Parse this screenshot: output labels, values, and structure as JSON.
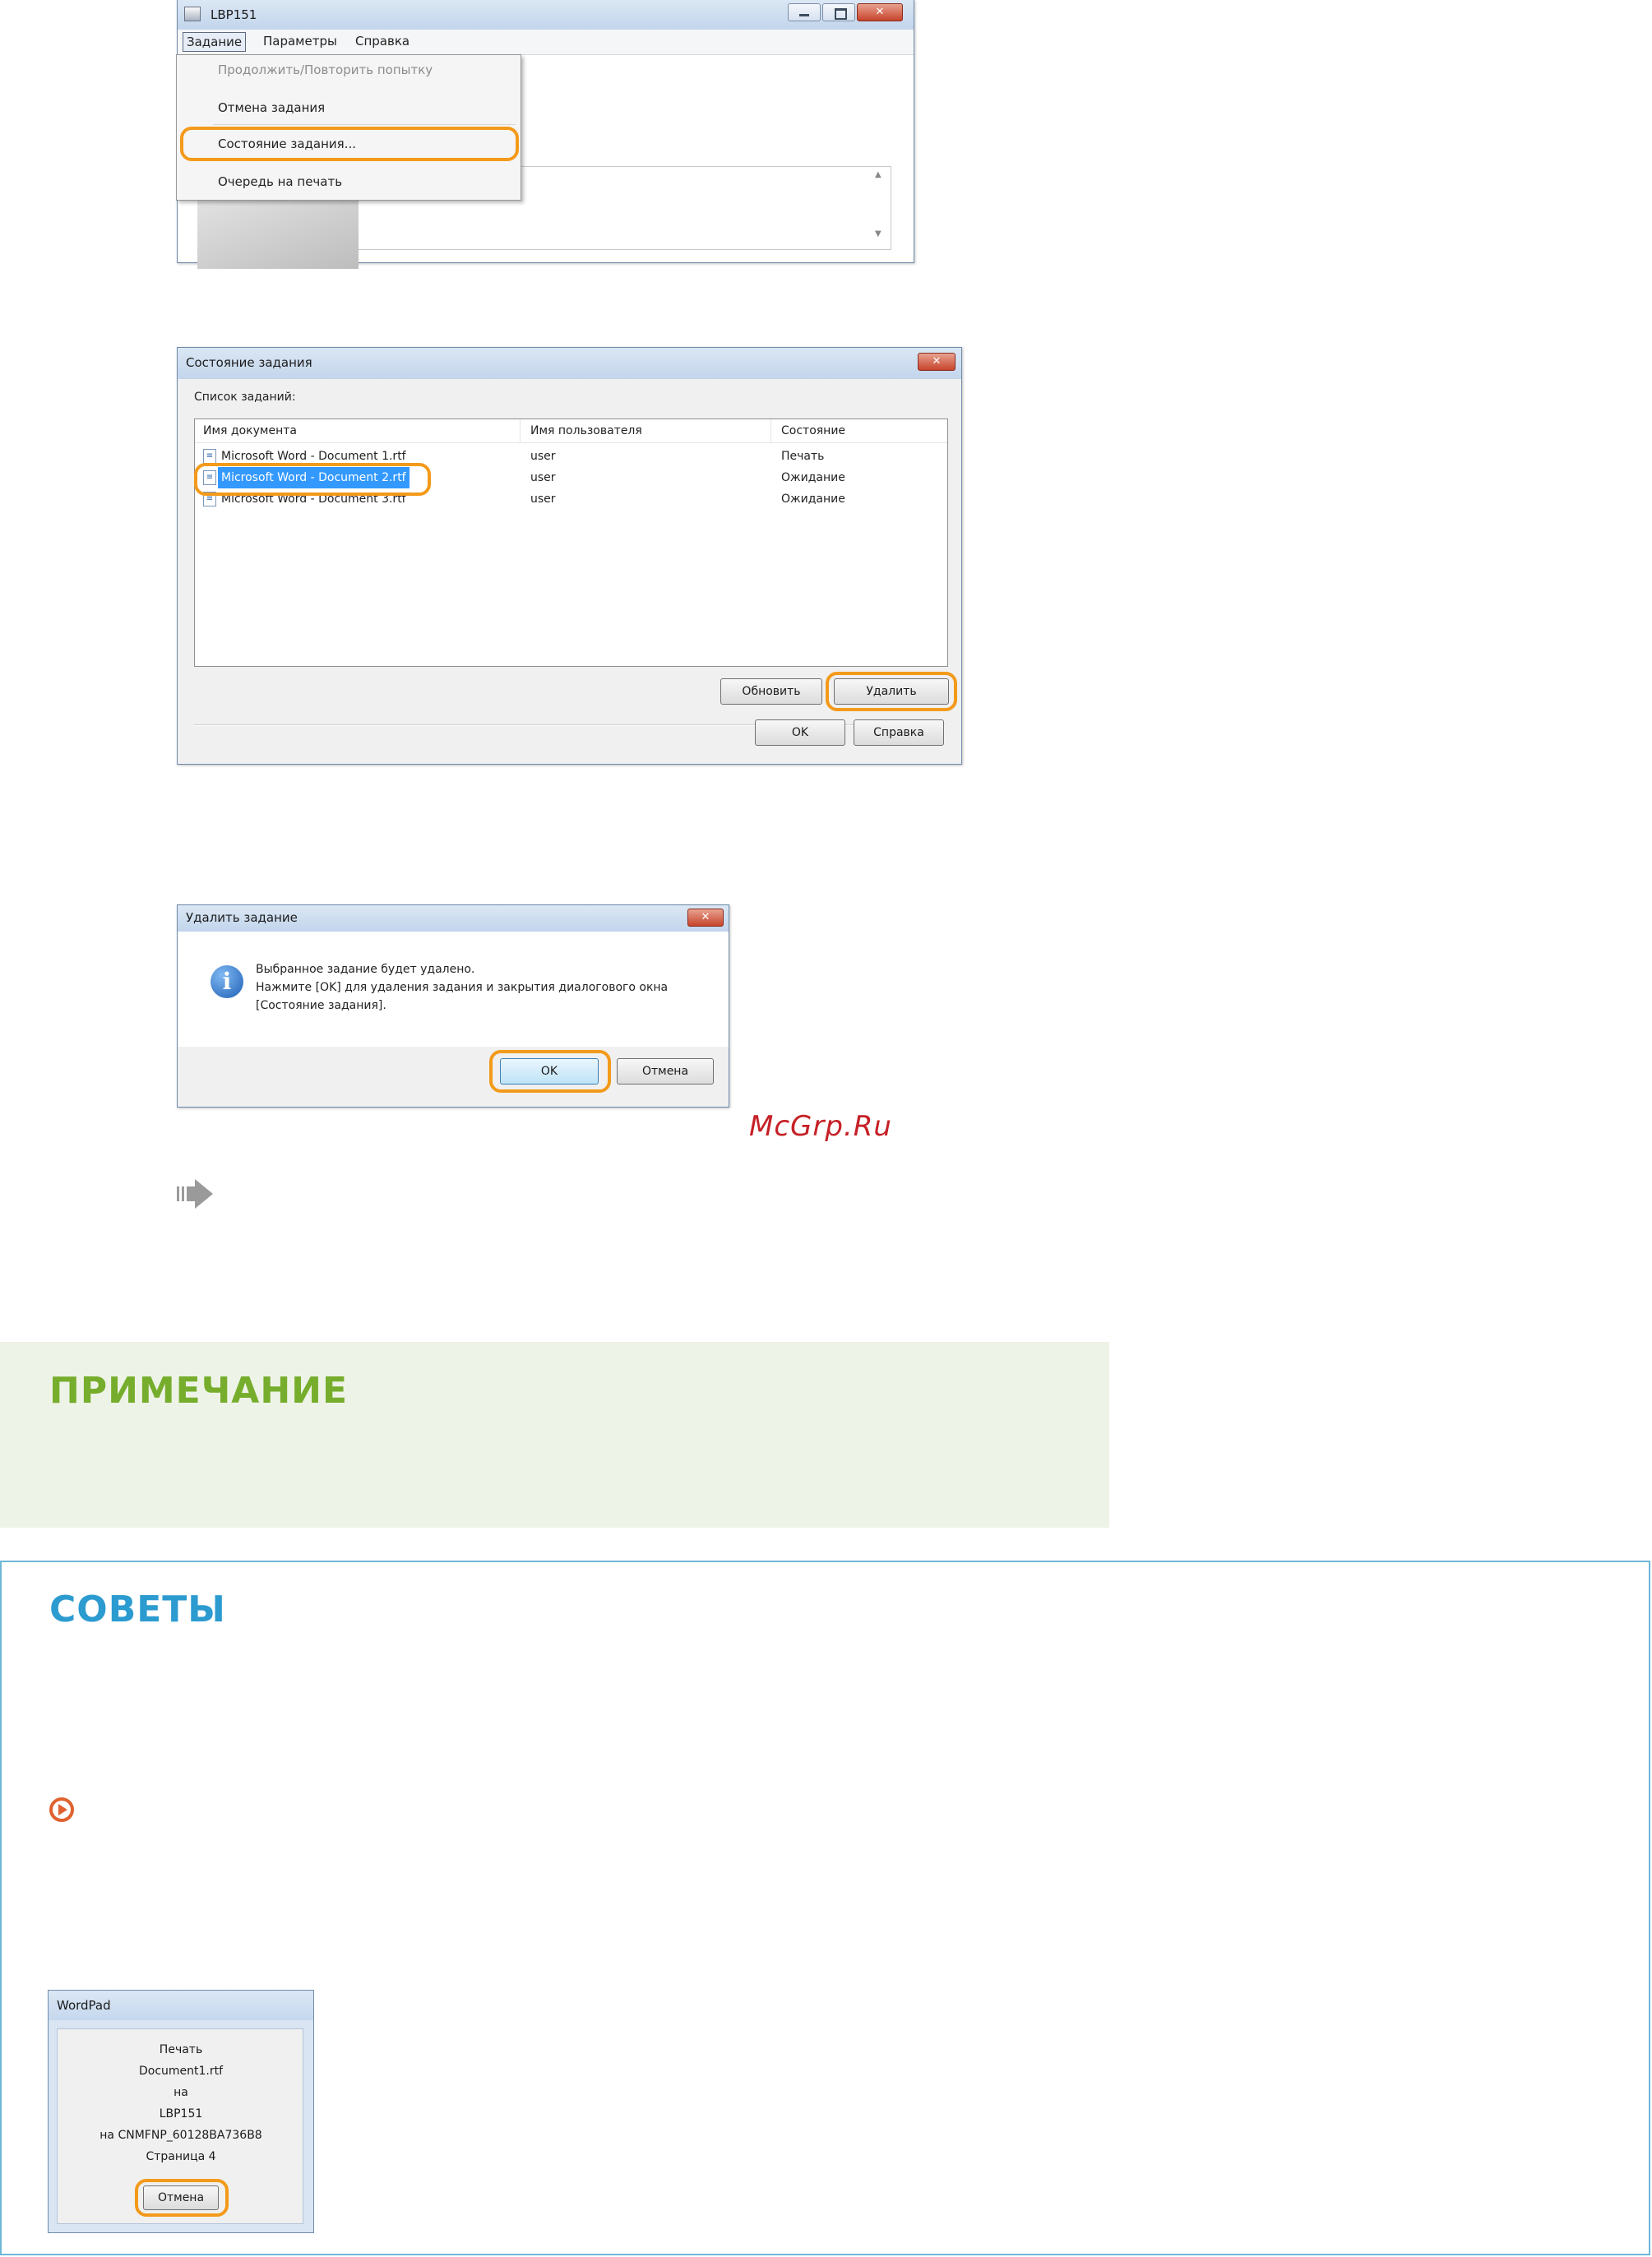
{
  "screen1": {
    "window_title": "LBP151",
    "menus": [
      "Задание",
      "Параметры",
      "Справка"
    ],
    "dropdown_items": [
      "Продолжить/Повторить попытку",
      "Отмена задания",
      "Состояние задания...",
      "Очередь на печать"
    ]
  },
  "screen2": {
    "title": "Состояние задания",
    "list_label": "Список заданий:",
    "columns": [
      "Имя документа",
      "Имя пользователя",
      "Состояние"
    ],
    "rows": [
      {
        "doc": "Microsoft Word - Document 1.rtf",
        "user": "user",
        "status": "Печать"
      },
      {
        "doc": "Microsoft Word - Document 2.rtf",
        "user": "user",
        "status": "Ожидание"
      },
      {
        "doc": "Microsoft Word - Document 3.rtf",
        "user": "user",
        "status": "Ожидание"
      }
    ],
    "buttons": {
      "refresh": "Обновить",
      "delete": "Удалить",
      "ok": "OK",
      "help": "Справка"
    }
  },
  "screen3": {
    "title": "Удалить задание",
    "message": [
      "Выбранное задание будет удалено.",
      "Нажмите [OK] для удаления задания и закрытия диалогового окна",
      "[Состояние задания]."
    ],
    "buttons": {
      "ok": "OK",
      "cancel": "Отмена"
    }
  },
  "watermark": "McGrp.Ru",
  "note_title": "ПРИМЕЧАНИЕ",
  "tips_title": "СОВЕТЫ",
  "screen4": {
    "title": "WordPad",
    "lines": [
      "Печать",
      "Document1.rtf",
      "на",
      "LBP151",
      "на CNMFNP_60128BA736B8",
      "Страница 4"
    ],
    "cancel": "Отмена"
  },
  "colors": {
    "highlight": "#f39a1a",
    "note_bg": "#eef3e7",
    "note_title": "#76ad2c",
    "tips_border": "#6fb6d8",
    "tips_title": "#2c9bd0",
    "watermark": "#c62026",
    "selection": "#3399ff"
  }
}
